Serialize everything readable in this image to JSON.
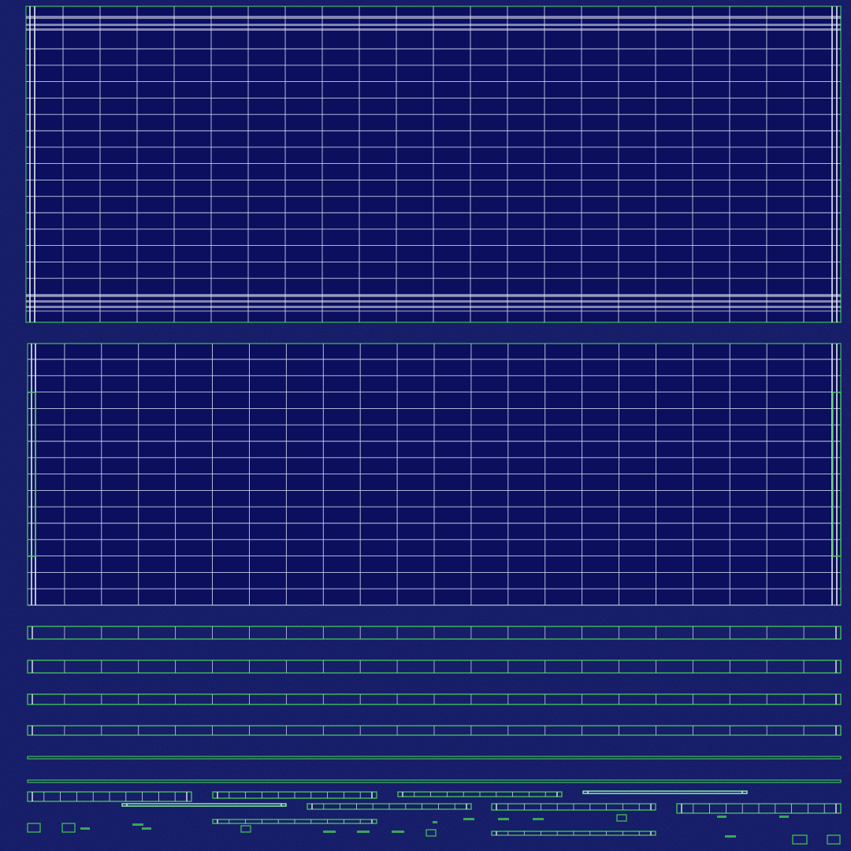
{
  "colors": {
    "background": "#0a1160",
    "panel_fill": "#0b0f5e",
    "grid_line": "#c9cbe6",
    "edge_green": "#3fbf55",
    "bright_green": "#8dffa0",
    "stripe_white": "#e6e8f5",
    "texture_gray": "#5a5f88"
  },
  "icons": {
    "large_panel": "uv-grid-panel",
    "strip": "uv-strip",
    "small_part": "uv-island"
  }
}
